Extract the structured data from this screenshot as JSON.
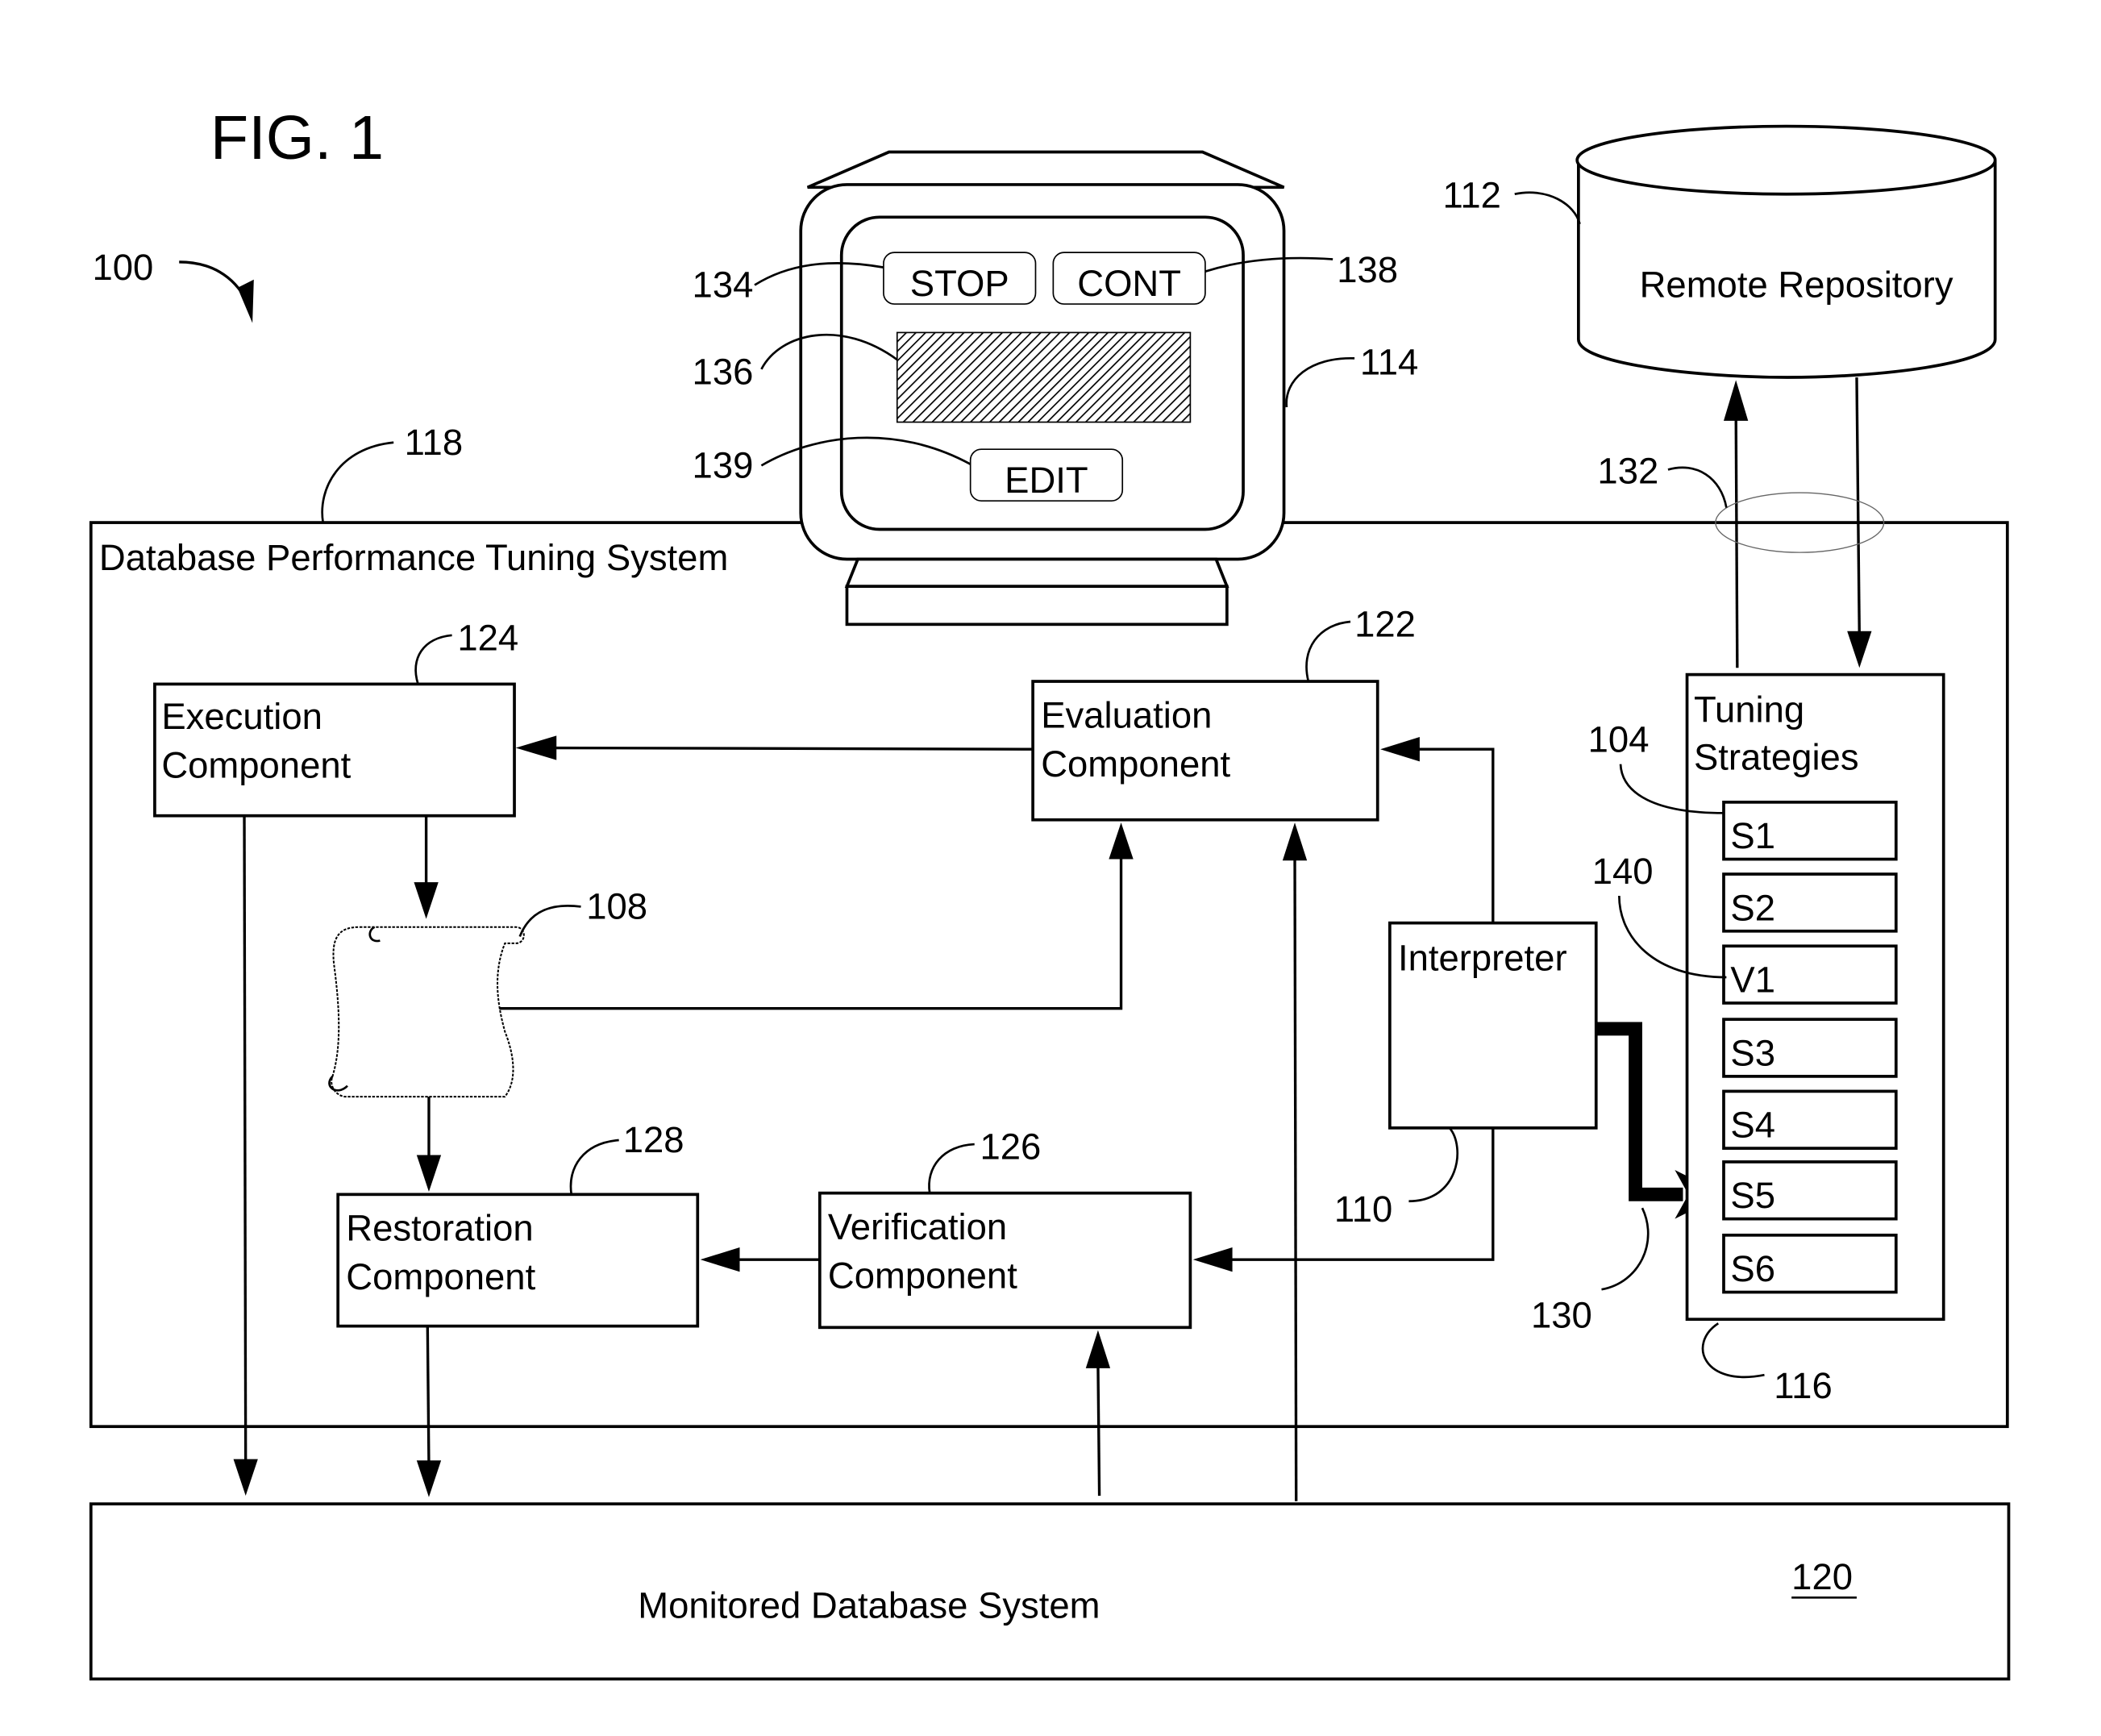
{
  "figure": {
    "title": "FIG. 1",
    "ref_system": "100"
  },
  "monitor": {
    "ref": "114",
    "buttons": {
      "stop": {
        "label": "STOP",
        "ref": "134"
      },
      "cont": {
        "label": "CONT",
        "ref": "138"
      },
      "edit": {
        "label": "EDIT",
        "ref": "139"
      }
    },
    "display_ref": "136"
  },
  "repository": {
    "label": "Remote Repository",
    "ref": "112",
    "link_ref": "132"
  },
  "tuning_system": {
    "label": "Database Performance Tuning System",
    "ref": "118"
  },
  "components": {
    "execution": {
      "line1": "Execution",
      "line2": "Component",
      "ref": "124"
    },
    "evaluation": {
      "line1": "Evaluation",
      "line2": "Component",
      "ref": "122"
    },
    "restoration": {
      "line1": "Restoration",
      "line2": "Component",
      "ref": "128"
    },
    "verification": {
      "line1": "Verification",
      "line2": "Component",
      "ref": "126"
    },
    "interpreter": {
      "label": "Interpreter",
      "ref": "110"
    },
    "script": {
      "ref": "108"
    }
  },
  "strategies": {
    "line1": "Tuning",
    "line2": "Strategies",
    "ref": "116",
    "item_ref_first": "104",
    "item_ref_v1": "140",
    "selection_ref": "130",
    "items": [
      "S1",
      "S2",
      "V1",
      "S3",
      "S4",
      "S5",
      "S6"
    ]
  },
  "monitored_db": {
    "label": "Monitored Database System",
    "ref": "120"
  }
}
